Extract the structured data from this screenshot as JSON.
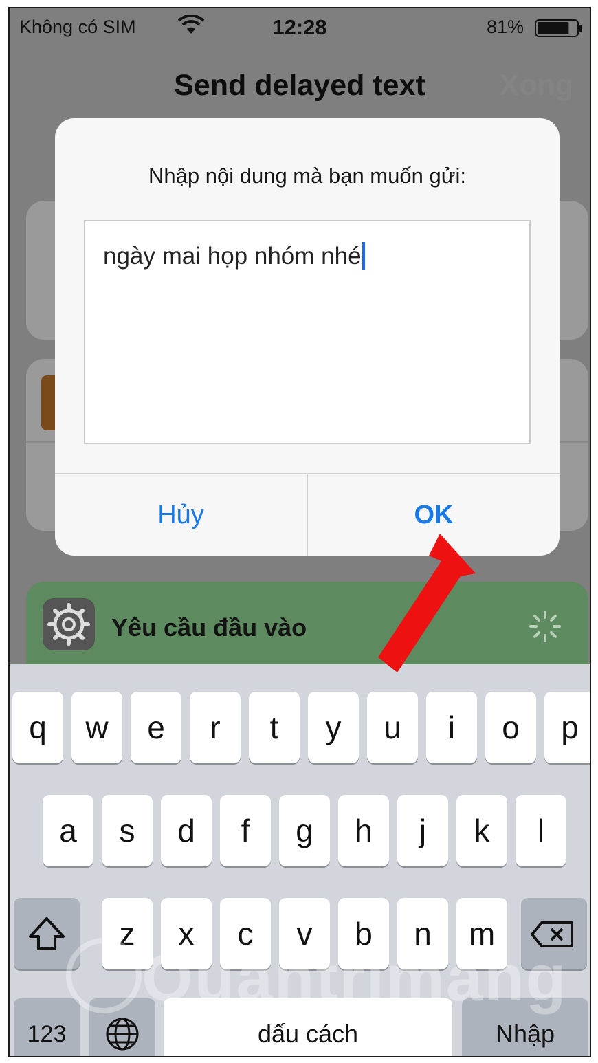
{
  "status_bar": {
    "carrier": "Không có SIM",
    "time": "12:28",
    "battery_percent": "81%",
    "battery_level": 0.81
  },
  "nav": {
    "title": "Send delayed text",
    "done_label": "Xong"
  },
  "alert": {
    "message": "Nhập nội dung mà bạn muốn gửi:",
    "input_value": "ngày mai họp nhóm nhé",
    "cancel_label": "Hủy",
    "ok_label": "OK"
  },
  "action_card": {
    "label": "Yêu cầu đầu vào",
    "icon": "gear-icon",
    "status_icon": "spinner-icon",
    "color": "#5e8a5f"
  },
  "keyboard": {
    "row1": [
      "q",
      "w",
      "e",
      "r",
      "t",
      "y",
      "u",
      "i",
      "o",
      "p"
    ],
    "row2": [
      "a",
      "s",
      "d",
      "f",
      "g",
      "h",
      "j",
      "k",
      "l"
    ],
    "row3": [
      "z",
      "x",
      "c",
      "v",
      "b",
      "n",
      "m"
    ],
    "shift_icon": "shift-icon",
    "delete_icon": "delete-icon",
    "numbers_label": "123",
    "globe_icon": "globe-icon",
    "space_label": "dấu cách",
    "return_label": "Nhập"
  },
  "watermark": {
    "text": "Quantrimang"
  },
  "colors": {
    "accent": "#1a7ae6",
    "arrow": "#ee1111"
  }
}
